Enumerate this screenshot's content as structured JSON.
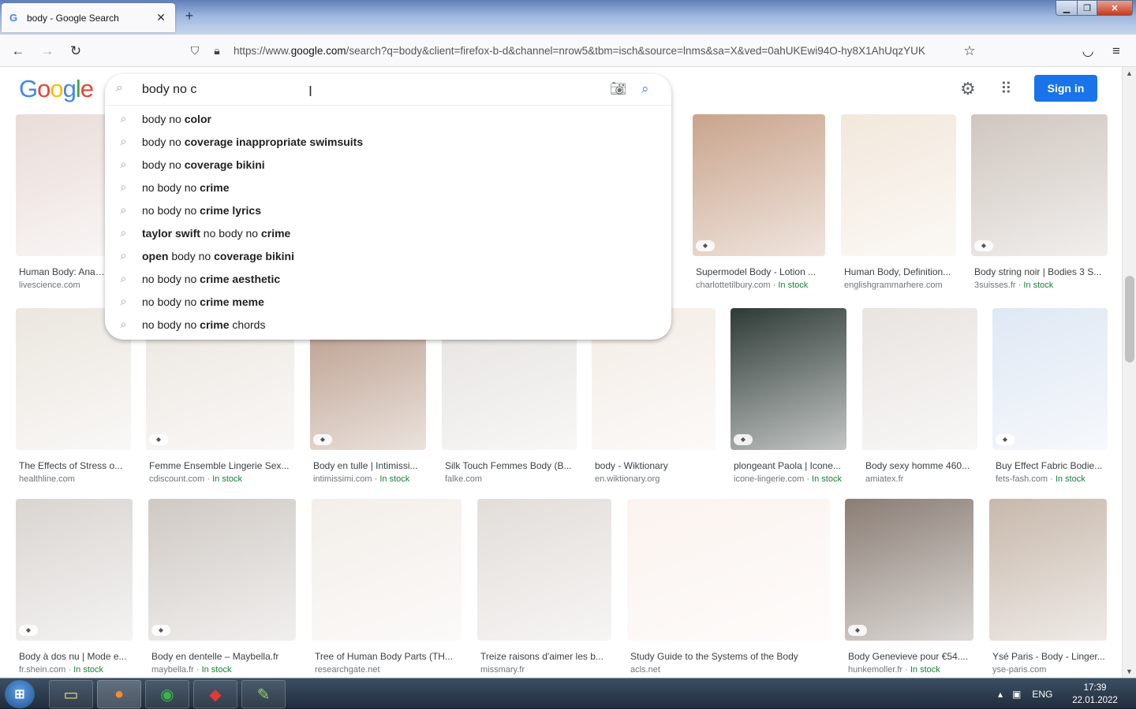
{
  "browser": {
    "tab_title": "body - Google Search",
    "tab_favicon": "G",
    "new_tab_symbol": "+",
    "close_symbol": "✕",
    "url_prefix": "https://www.",
    "url_domain": "google.com",
    "url_rest": "/search?q=body&client=firefox-b-d&channel=nrow5&tbm=isch&source=lnms&sa=X&ved=0ahUKEwi94O-hy8X1AhUqzYUK"
  },
  "google": {
    "logo_letters": [
      "G",
      "o",
      "o",
      "g",
      "l",
      "e"
    ],
    "logo_colors": [
      "#4285f4",
      "#ea4335",
      "#fbbc05",
      "#4285f4",
      "#34a853",
      "#ea4335"
    ],
    "sign_in": "Sign in"
  },
  "search": {
    "query": "body no c",
    "suggestions": [
      {
        "plain": "body no ",
        "bold": "color",
        "tail": ""
      },
      {
        "plain": "body no ",
        "bold": "coverage inappropriate swimsuits",
        "tail": ""
      },
      {
        "plain": "body no ",
        "bold": "coverage bikini",
        "tail": ""
      },
      {
        "plain": "no body no ",
        "bold": "crime",
        "tail": ""
      },
      {
        "plain": "no body no ",
        "bold": "crime lyrics",
        "tail": ""
      },
      {
        "lead_bold": "taylor swift",
        "plain": " no body no ",
        "bold": "crime",
        "tail": ""
      },
      {
        "lead_bold": "open",
        "plain": " body no ",
        "bold": "coverage bikini",
        "tail": ""
      },
      {
        "plain": "no body no ",
        "bold": "crime aesthetic",
        "tail": ""
      },
      {
        "plain": "no body no ",
        "bold": "crime meme",
        "tail": ""
      },
      {
        "plain": "no body no ",
        "bold": "crime ",
        "tail": "chords"
      }
    ]
  },
  "results": {
    "in_stock_label": "In stock",
    "row1": [
      {
        "caption": "Human Body: Anatomy",
        "source": "livescience.com",
        "stock": false,
        "tag": false,
        "color": "#e9dcd8"
      },
      {
        "caption": "Supermodel Body - Lotion ...",
        "source": "charlottetilbury.com",
        "stock": true,
        "tag": true,
        "color": "#c9a48c"
      },
      {
        "caption": "Human Body, Definition...",
        "source": "englishgrammarhere.com",
        "stock": false,
        "tag": false,
        "color": "#f2e8dc"
      },
      {
        "caption": "Body string noir | Bodies 3 S...",
        "source": "3suisses.fr",
        "stock": true,
        "tag": true,
        "color": "#cfc6bf"
      }
    ],
    "row2": [
      {
        "caption": "The Effects of Stress o...",
        "source": "healthline.com",
        "stock": false,
        "tag": false,
        "color": "#ebe6df"
      },
      {
        "caption": "Femme Ensemble Lingerie Sex...",
        "source": "cdiscount.com",
        "stock": true,
        "tag": true,
        "color": "#ece6e0"
      },
      {
        "caption": "Body en tulle | Intimissi...",
        "source": "intimissimi.com",
        "stock": true,
        "tag": true,
        "color": "#b89a88"
      },
      {
        "caption": "Silk Touch Femmes Body (B...",
        "source": "falke.com",
        "stock": false,
        "tag": false,
        "color": "#e6e3e0"
      },
      {
        "caption": "body - Wiktionary",
        "source": "en.wiktionary.org",
        "stock": false,
        "tag": false,
        "color": "#f4ece6"
      },
      {
        "caption": "plongeant Paola | Icone...",
        "source": "icone-lingerie.com",
        "stock": true,
        "tag": true,
        "color": "#2e3a36"
      },
      {
        "caption": "Body sexy homme 460...",
        "source": "amiatex.fr",
        "stock": false,
        "tag": false,
        "color": "#e8e4e0"
      },
      {
        "caption": "Buy Effect Fabric Bodie...",
        "source": "fets-fash.com",
        "stock": true,
        "tag": true,
        "color": "#dfe8f4"
      }
    ],
    "row3": [
      {
        "caption": "Body à dos nu | Mode e...",
        "source": "fr.shein.com",
        "stock": true,
        "tag": true,
        "color": "#d9d5d1"
      },
      {
        "caption": "Body en dentelle – Maybella.fr",
        "source": "maybella.fr",
        "stock": true,
        "tag": true,
        "color": "#cfc9c4"
      },
      {
        "caption": "Tree of Human Body Parts (TH...",
        "source": "researchgate.net",
        "stock": false,
        "tag": false,
        "color": "#f3eee9"
      },
      {
        "caption": "Treize raisons d'aimer les b...",
        "source": "missmary.fr",
        "stock": false,
        "tag": false,
        "color": "#e2ddd9"
      },
      {
        "caption": "Study Guide to the Systems of the Body",
        "source": "acls.net",
        "stock": false,
        "tag": false,
        "color": "#fbf3ef"
      },
      {
        "caption": "Body Genevieve pour €54....",
        "source": "hunkemoller.fr",
        "stock": true,
        "tag": true,
        "color": "#8a7d74"
      },
      {
        "caption": "Ysé Paris - Body - Linger...",
        "source": "yse-paris.com",
        "stock": false,
        "tag": false,
        "color": "#c7b8ab"
      }
    ]
  },
  "taskbar": {
    "language": "ENG",
    "time": "17:39",
    "date": "22.01.2022"
  }
}
